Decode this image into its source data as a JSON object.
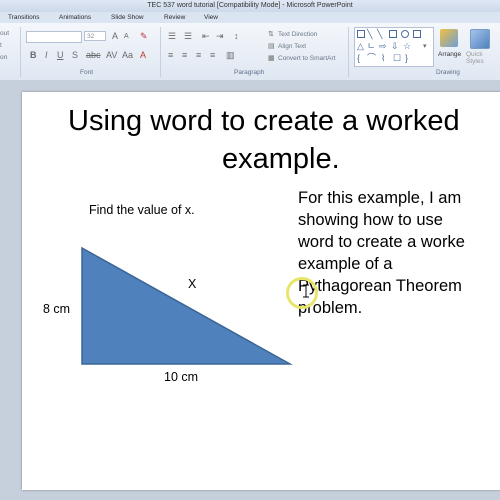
{
  "window": {
    "title": "TEC 537 word tutorial [Compatibility Mode] - Microsoft PowerPoint"
  },
  "tabs": [
    "Transitions",
    "Animations",
    "Slide Show",
    "Review",
    "View"
  ],
  "ribbon": {
    "font_size": "32",
    "groups": {
      "font": "Font",
      "paragraph": "Paragraph",
      "drawing": "Drawing"
    },
    "paragraph_buttons": [
      "Text Direction",
      "Align Text",
      "Convert to SmartArt"
    ],
    "drawing_buttons": [
      "Arrange",
      "Quick Styles"
    ],
    "left_fragments": [
      "out",
      "t",
      "on"
    ]
  },
  "slide": {
    "title_line1": "Using word to create a worked",
    "title_line2": "example.",
    "prompt": "Find the value of x.",
    "body_lines": [
      "For this example,  I am",
      "showing  how to use",
      "word to create  a worke",
      "example  of a",
      "Pythagorean  Theorem",
      "problem."
    ],
    "triangle": {
      "fill_color": "#4f81bd",
      "side_label_left": "8 cm",
      "side_label_bottom": "10 cm",
      "hypotenuse_label": "X"
    }
  },
  "colors": {
    "ribbon_bg": "#e4ebf5",
    "workspace_bg": "#c6cfdc",
    "highlight_ring": "#e9e56a"
  }
}
